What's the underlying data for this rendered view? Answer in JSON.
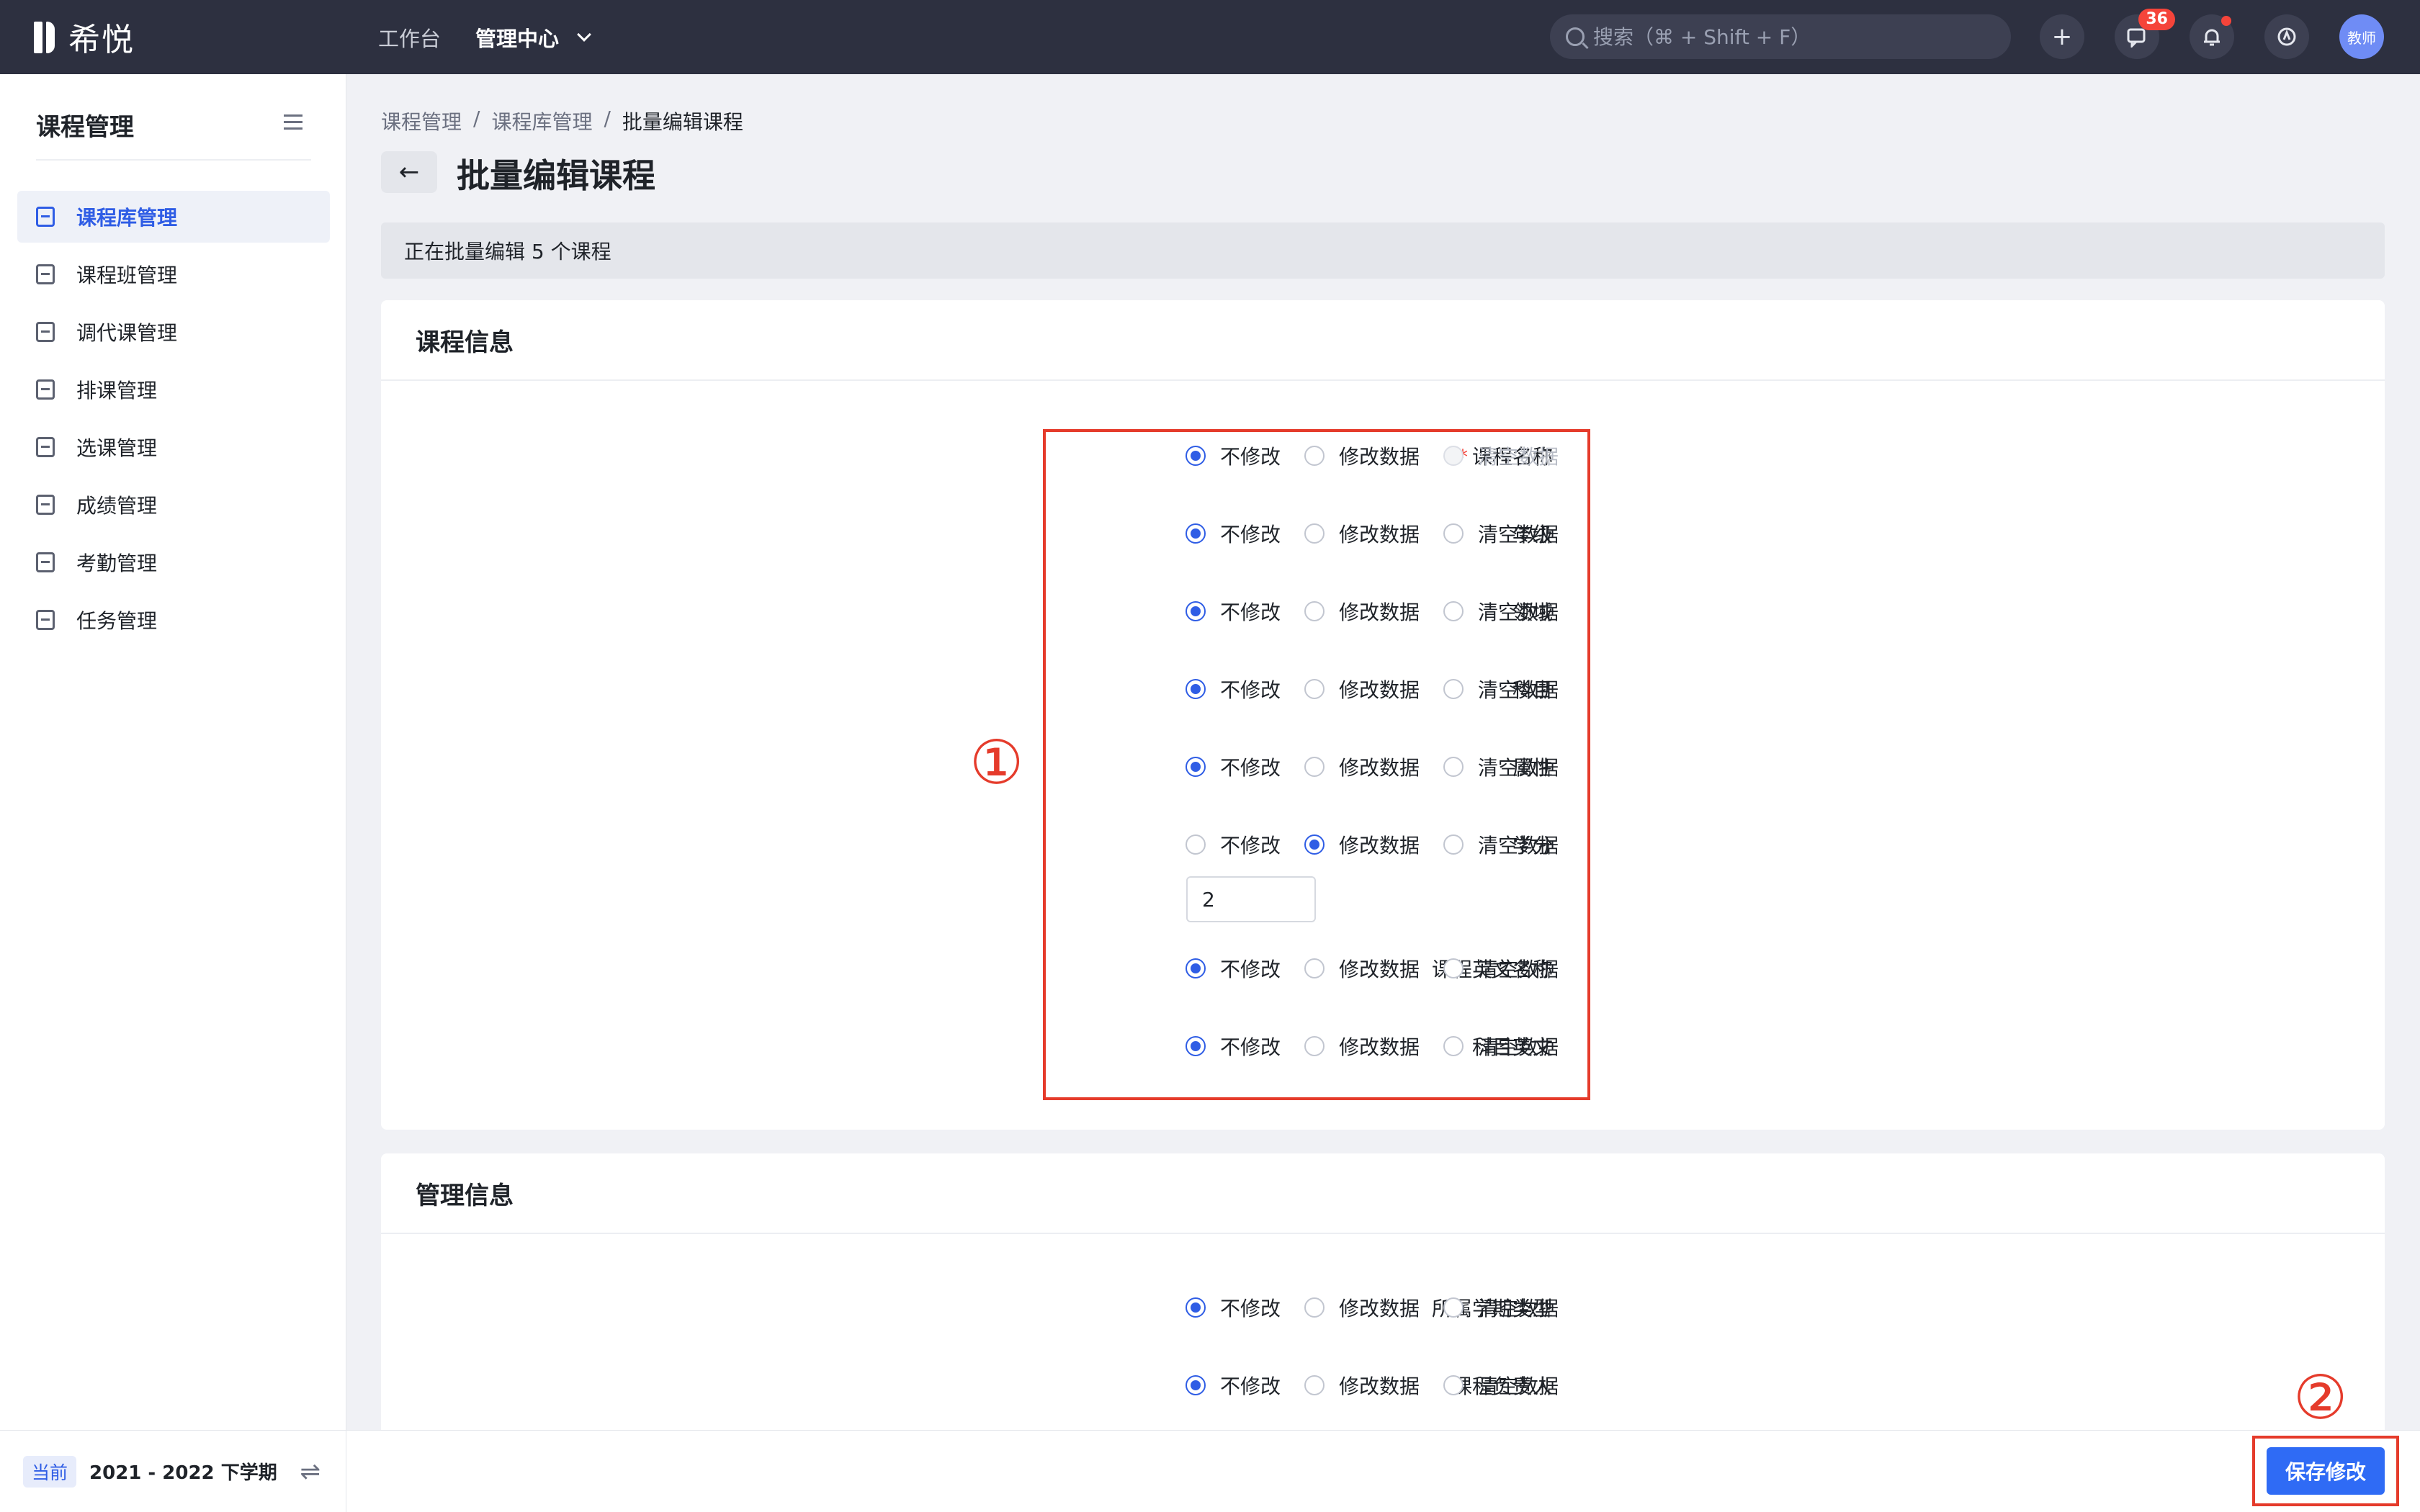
{
  "topbar": {
    "logo_text": "希悦",
    "nav": [
      {
        "label": "工作台"
      },
      {
        "label": "管理中心"
      }
    ],
    "search_placeholder": "搜索（⌘ + Shift + F）",
    "messages_badge": "36",
    "avatar_text": "教师"
  },
  "sidebar": {
    "title": "课程管理",
    "items": [
      {
        "label": "课程库管理",
        "active": true
      },
      {
        "label": "课程班管理"
      },
      {
        "label": "调代课管理"
      },
      {
        "label": "排课管理"
      },
      {
        "label": "选课管理"
      },
      {
        "label": "成绩管理"
      },
      {
        "label": "考勤管理"
      },
      {
        "label": "任务管理"
      }
    ],
    "footer": {
      "tag": "当前",
      "term": "2021 - 2022 下学期"
    }
  },
  "breadcrumb": [
    "课程管理",
    "/",
    "课程库管理",
    "/",
    "批量编辑课程"
  ],
  "page_title": "批量编辑课程",
  "notice": "正在批量编辑 5 个课程",
  "options": {
    "keep": "不修改",
    "modify": "修改数据",
    "clear": "清空数据"
  },
  "course_info": {
    "title": "课程信息",
    "fields": [
      {
        "label": "课程名称",
        "required": true,
        "selected": "keep",
        "clear_disabled": true
      },
      {
        "label": "年级",
        "selected": "keep"
      },
      {
        "label": "领域",
        "selected": "keep"
      },
      {
        "label": "科目",
        "selected": "keep"
      },
      {
        "label": "属性",
        "selected": "keep"
      },
      {
        "label": "学分",
        "selected": "modify",
        "value": "2"
      },
      {
        "label": "课程英文名称",
        "selected": "keep"
      },
      {
        "label": "科目英文",
        "selected": "keep"
      }
    ]
  },
  "management_info": {
    "title": "管理信息",
    "fields": [
      {
        "label": "所属学期类型",
        "selected": "keep"
      },
      {
        "label": "课程负责人",
        "selected": "keep"
      }
    ]
  },
  "annotations": {
    "one": "①",
    "two": "②"
  },
  "save_label": "保存修改",
  "colors": {
    "accent": "#2f5de5",
    "annotation": "#e53b2b",
    "topbar": "#2d3040"
  }
}
